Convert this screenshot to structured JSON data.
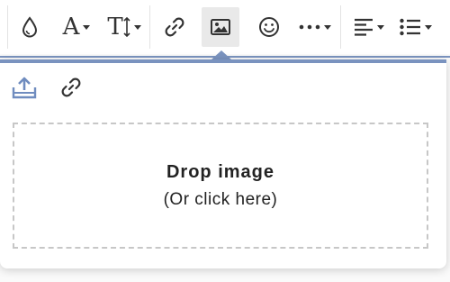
{
  "toolbar": {
    "items": [
      {
        "icon": "color-drop-icon"
      },
      {
        "icon": "font-family-icon",
        "label": "A"
      },
      {
        "icon": "font-size-icon",
        "label": "T"
      },
      {
        "icon": "link-icon"
      },
      {
        "icon": "image-icon"
      },
      {
        "icon": "emoji-icon"
      },
      {
        "icon": "more-icon"
      },
      {
        "icon": "align-icon"
      },
      {
        "icon": "list-icon"
      }
    ]
  },
  "popover": {
    "accent_color": "#7a93bf",
    "tabs": [
      {
        "icon": "upload-icon",
        "active": true
      },
      {
        "icon": "link-icon",
        "active": false
      }
    ],
    "drop_zone": {
      "title": "Drop image",
      "subtitle": "(Or click here)"
    }
  }
}
